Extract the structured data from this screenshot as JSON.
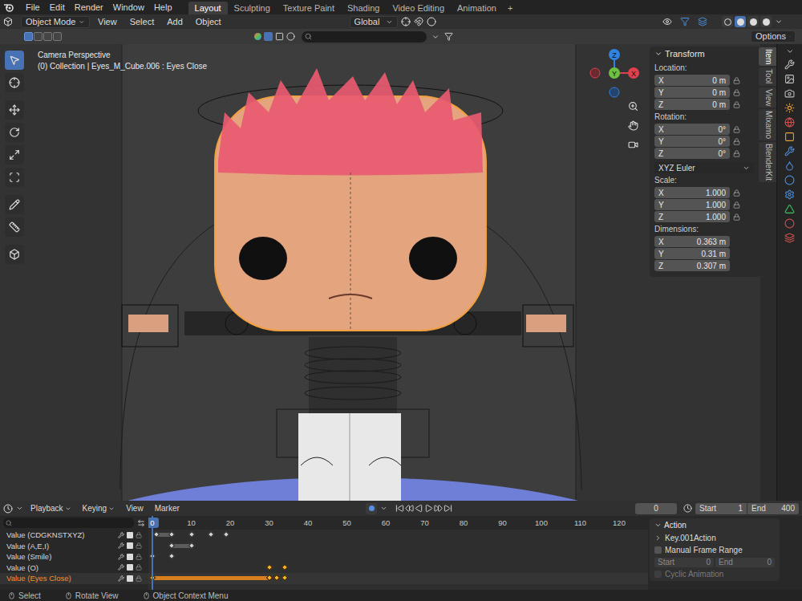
{
  "menubar": {
    "menus": [
      "File",
      "Edit",
      "Render",
      "Window",
      "Help"
    ],
    "workspaces": [
      {
        "label": "Layout",
        "selected": true
      },
      {
        "label": "Sculpting",
        "selected": false
      },
      {
        "label": "Texture Paint",
        "selected": false
      },
      {
        "label": "Shading",
        "selected": false
      },
      {
        "label": "Video Editing",
        "selected": false
      },
      {
        "label": "Animation",
        "selected": false
      }
    ],
    "add_tab": "+"
  },
  "header": {
    "mode": "Object Mode",
    "menus": [
      "View",
      "Select",
      "Add",
      "Object"
    ],
    "orientation": "Global",
    "shading": [
      {
        "selected": false
      },
      {
        "selected": true
      },
      {
        "selected": false
      },
      {
        "selected": false
      }
    ]
  },
  "tool_header": {
    "select_modes": [
      {
        "selected": true
      },
      {
        "selected": false
      },
      {
        "selected": false
      },
      {
        "selected": false
      }
    ],
    "options": "Options"
  },
  "viewport": {
    "view_name": "Camera Perspective",
    "context": "(0) Collection | Eyes_M_Cube.006 : Eyes Close",
    "gizmo": {
      "x": "X",
      "y": "Y",
      "z": "Z"
    },
    "tools": [
      {
        "selected": true
      },
      {
        "selected": false
      },
      {
        "selected": false
      },
      {
        "selected": false
      },
      {
        "selected": false
      },
      {
        "selected": false
      },
      {
        "selected": false
      },
      {
        "selected": false
      },
      {
        "selected": false
      }
    ]
  },
  "sidebar": {
    "panel": "Transform",
    "groups": [
      {
        "label": "Location:",
        "fields": [
          {
            "axis": "X",
            "value": "0 m"
          },
          {
            "axis": "Y",
            "value": "0 m"
          },
          {
            "axis": "Z",
            "value": "0 m"
          }
        ],
        "locks": true
      },
      {
        "label": "Rotation:",
        "fields": [
          {
            "axis": "X",
            "value": "0°"
          },
          {
            "axis": "Y",
            "value": "0°"
          },
          {
            "axis": "Z",
            "value": "0°"
          }
        ],
        "locks": true
      },
      {
        "label": "Scale:",
        "fields": [
          {
            "axis": "X",
            "value": "1.000"
          },
          {
            "axis": "Y",
            "value": "1.000"
          },
          {
            "axis": "Z",
            "value": "1.000"
          }
        ],
        "locks": true
      },
      {
        "label": "Dimensions:",
        "fields": [
          {
            "axis": "X",
            "value": "0.363 m"
          },
          {
            "axis": "Y",
            "value": "0.31 m"
          },
          {
            "axis": "Z",
            "value": "0.307 m"
          }
        ],
        "locks": false
      }
    ],
    "rotation_mode": "XYZ Euler",
    "tabs": [
      {
        "label": "Item",
        "selected": true
      },
      {
        "label": "Tool",
        "selected": false
      },
      {
        "label": "View",
        "selected": false
      },
      {
        "label": "Mixamo",
        "selected": false
      },
      {
        "label": "BlenderKit",
        "selected": false
      }
    ]
  },
  "timeline": {
    "menus": [
      "Playback",
      "Keying",
      "View",
      "Marker"
    ],
    "frame_field": "0",
    "start": {
      "label": "Start",
      "value": "1"
    },
    "end": {
      "label": "End",
      "value": "400"
    },
    "current_frame": "0",
    "ruler": [
      "10",
      "20",
      "30",
      "40",
      "50",
      "60",
      "70",
      "80",
      "90",
      "100",
      "110",
      "120"
    ],
    "channels": [
      {
        "name": "Value (CDGKNSTXYZ)",
        "selected": false,
        "keys": [
          {
            "frame": 1,
            "selected": false
          },
          {
            "frame": 5,
            "selected": false
          },
          {
            "frame": 10,
            "selected": false
          },
          {
            "frame": 15,
            "selected": false
          },
          {
            "frame": 19,
            "selected": false
          }
        ],
        "holds": [
          [
            1,
            5
          ]
        ]
      },
      {
        "name": "Value (A,E,I)",
        "selected": false,
        "keys": [
          {
            "frame": 5,
            "selected": false
          },
          {
            "frame": 10,
            "selected": false
          }
        ],
        "holds": [
          [
            5,
            10
          ]
        ]
      },
      {
        "name": "Value (Smile)",
        "selected": false,
        "keys": [
          {
            "frame": 0,
            "selected": false
          },
          {
            "frame": 5,
            "selected": false
          }
        ],
        "holds": []
      },
      {
        "name": "Value (O)",
        "selected": false,
        "keys": [
          {
            "frame": 30,
            "selected": true
          },
          {
            "frame": 34,
            "selected": true
          }
        ],
        "holds": []
      },
      {
        "name": "Value (Eyes Close)",
        "selected": true,
        "keys": [
          {
            "frame": 0,
            "selected": true
          },
          {
            "frame": 30,
            "selected": true
          },
          {
            "frame": 32,
            "selected": true
          },
          {
            "frame": 34,
            "selected": true
          }
        ],
        "holds": [
          [
            0,
            30
          ]
        ]
      }
    ]
  },
  "action": {
    "header": "Action",
    "name": "Key.001Action",
    "manual_frame_range": {
      "label": "Manual Frame Range",
      "checked": false
    },
    "start": {
      "label": "Start",
      "value": "0"
    },
    "end": {
      "label": "End",
      "value": "0"
    },
    "cyclic": {
      "label": "Cyclic Animation",
      "checked": false,
      "disabled": true
    }
  },
  "status_bar": [
    "Select",
    "Rotate View",
    "Object Context Menu"
  ]
}
